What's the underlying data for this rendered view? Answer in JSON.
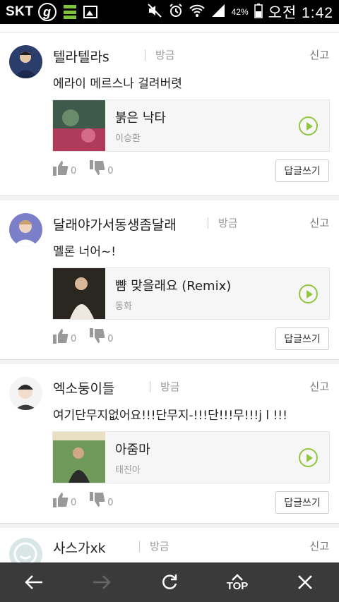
{
  "status_bar": {
    "carrier": "SKT",
    "battery": "42%",
    "time": "오전 1:42",
    "icons": [
      "g-icon",
      "stack-icon",
      "gallery-icon",
      "mute-icon",
      "alarm-icon",
      "wifi-icon",
      "signal-icon",
      "battery-icon"
    ]
  },
  "comments": [
    {
      "nickname": "텔라텔라s",
      "time": "방금",
      "report_label": "신고",
      "text": "에라이 메르스나 걸려버렷",
      "song": {
        "title": "붉은 낙타",
        "artist": "이승환"
      },
      "likes": "0",
      "dislikes": "0",
      "reply_label": "답글쓰기"
    },
    {
      "nickname": "달래야가서동생좀달래",
      "time": "방금",
      "report_label": "신고",
      "text": "멜론 너어~!",
      "song": {
        "title": "뺨 맞을래요 (Remix)",
        "artist": "동화"
      },
      "likes": "0",
      "dislikes": "0",
      "reply_label": "답글쓰기"
    },
    {
      "nickname": "엑소둥이들",
      "time": "방금",
      "report_label": "신고",
      "text": "여기단무지없어요!!!단무지-!!!단!!!무!!!j l !!!",
      "song": {
        "title": "아줌마",
        "artist": "태진아"
      },
      "likes": "0",
      "dislikes": "0",
      "reply_label": "답글쓰기"
    },
    {
      "nickname": "사스가xk",
      "time": "방금",
      "report_label": "신고"
    }
  ],
  "bottom_nav": {
    "top_label": "TOP",
    "icons": [
      "back-arrow-icon",
      "forward-arrow-icon",
      "refresh-icon",
      "top-icon",
      "close-icon"
    ]
  },
  "colors": {
    "accent_green": "#8fc63f",
    "bottom_bar": "#3a3a3a",
    "status_bar": "#000000"
  }
}
